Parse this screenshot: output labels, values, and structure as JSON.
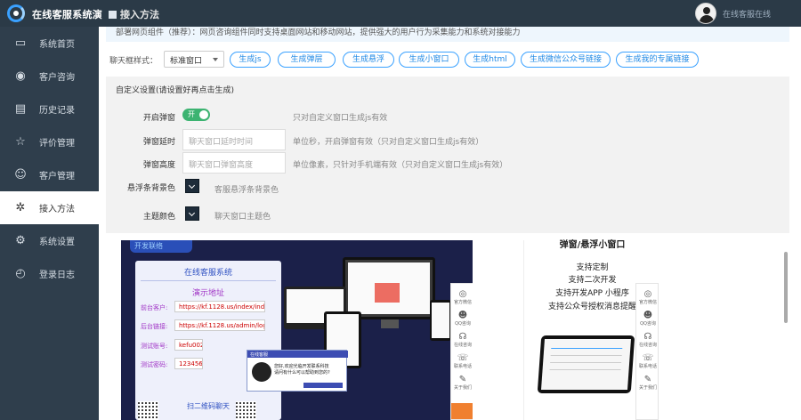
{
  "app": {
    "title": "在线客服系统演"
  },
  "page": {
    "title": "接入方法"
  },
  "user": {
    "status": "在线客服在线"
  },
  "sidebar": {
    "items": [
      {
        "label": "系统首页",
        "icon": "monitor-icon"
      },
      {
        "label": "客户咨询",
        "icon": "chat-icon"
      },
      {
        "label": "历史记录",
        "icon": "document-icon"
      },
      {
        "label": "评价管理",
        "icon": "star-icon"
      },
      {
        "label": "客户管理",
        "icon": "user-icon"
      },
      {
        "label": "接入方法",
        "icon": "plug-icon",
        "active": true
      },
      {
        "label": "系统设置",
        "icon": "gear-icon"
      },
      {
        "label": "登录日志",
        "icon": "clock-icon"
      }
    ]
  },
  "notice": "部署网页组件（推荐）：网页咨询组件同时支持桌面网站和移动网站，提供强大的用户行为采集能力和系统对接能力",
  "chat_style": {
    "label": "聊天框样式：",
    "selected": "标准窗口"
  },
  "buttons": [
    "生成js",
    "生成弹层",
    "生成悬浮",
    "生成小窗口",
    "生成html",
    "生成微信公众号链接",
    "生成我的专属链接"
  ],
  "settings": {
    "title": "自定义设置(请设置好再点击生成)",
    "popup_toggle": {
      "label": "开启弹窗",
      "state": "开",
      "hint": "只对自定义窗口生成js有效"
    },
    "popup_delay": {
      "label": "弹窗延时",
      "placeholder": "聊天窗口延时时间",
      "hint": "单位秒，开启弹窗有效（只对自定义窗口生成js有效）"
    },
    "popup_height": {
      "label": "弹窗高度",
      "placeholder": "聊天窗口弹窗高度",
      "hint": "单位像素，只针对手机端有效（只对自定义窗口生成js有效）"
    },
    "float_bg": {
      "label": "悬浮条背景色",
      "hint": "客服悬浮条背景色"
    },
    "theme": {
      "label": "主题颜色",
      "hint": "聊天窗口主题色"
    }
  },
  "preview": {
    "brand": "开发联络",
    "card_title": "在线客服系统",
    "demo_title": "演示地址",
    "rows": [
      {
        "key": "前台客户:",
        "value": "https://kf.1128.us/index/index"
      },
      {
        "key": "后台链接:",
        "value": "https://kf.1128.us/admin/login"
      },
      {
        "key": "测试账号:",
        "value": "kefu002"
      },
      {
        "key": "测试密码:",
        "value": "123456"
      }
    ],
    "qr_title": "扫二维码聊天",
    "popup_head": "在线客服",
    "popup_text_1": "您好,欢迎光临开发联系科技",
    "popup_text_2": "请问有什么可以帮助到您的?",
    "dock": [
      {
        "label": "官方微信",
        "icon": "wechat-icon",
        "glyph": "◎"
      },
      {
        "label": "QQ咨询",
        "icon": "qq-icon",
        "glyph": "☻"
      },
      {
        "label": "在线咨询",
        "icon": "headset-icon",
        "glyph": "☊"
      },
      {
        "label": "联系电话",
        "icon": "phone-icon",
        "glyph": "☏"
      },
      {
        "label": "关于我们",
        "icon": "feather-icon",
        "glyph": "✎"
      }
    ],
    "headline": "弹窗/悬浮小窗口",
    "features": [
      "支持定制",
      "支持二次开发",
      "支持开发APP 小程序",
      "支持公众号授权消息提醒"
    ]
  },
  "colors": {
    "sidebar_bg": "#2f3e4c",
    "accent": "#3aa1ff",
    "toggle_on": "#3cb371",
    "swatch": "#1e2c3a"
  }
}
